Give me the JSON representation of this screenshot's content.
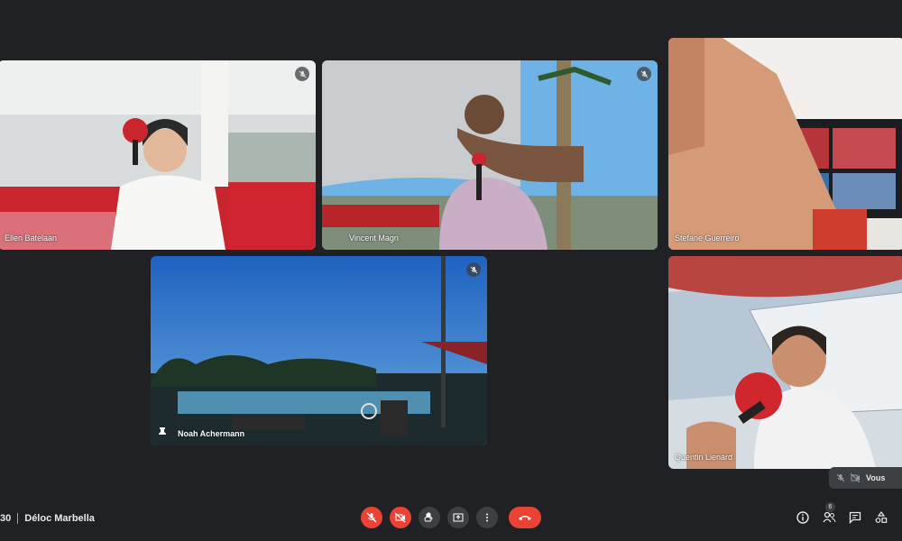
{
  "meeting": {
    "time_partial": "30",
    "title": "Déloc Marbella"
  },
  "participants": [
    {
      "name": "Ellen Batelaan",
      "muted": true
    },
    {
      "name": "Vincent Magn",
      "muted": true
    },
    {
      "name": "Stefane Guerreiro",
      "muted": false
    },
    {
      "name": "Noah Achermann",
      "muted": true,
      "pinned": true
    },
    {
      "name": "Quentin Lienard",
      "muted": false
    }
  ],
  "self_tile": {
    "label": "Vous"
  },
  "controls": {
    "buttons": [
      "mic-off-icon",
      "camera-off-icon",
      "raise-hand-icon",
      "present-icon",
      "more-options-icon",
      "end-call-icon"
    ]
  },
  "right_panel": {
    "participants_count": "6"
  },
  "colors": {
    "background": "#202124",
    "danger": "#ea4335",
    "control": "#3c4043"
  }
}
